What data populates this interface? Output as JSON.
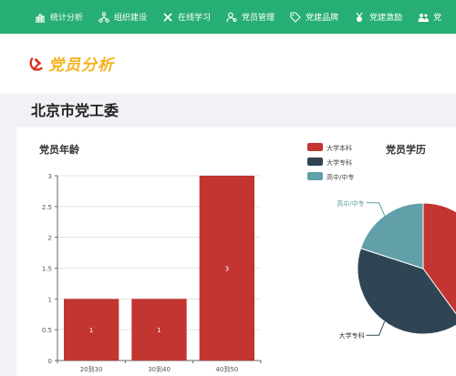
{
  "nav": {
    "items": [
      {
        "label": "统计分析",
        "icon": "bar-chart-icon"
      },
      {
        "label": "组织建设",
        "icon": "org-tree-icon"
      },
      {
        "label": "在线学习",
        "icon": "learning-icon"
      },
      {
        "label": "党员管理",
        "icon": "member-icon"
      },
      {
        "label": "党建品牌",
        "icon": "tag-icon"
      },
      {
        "label": "党建激励",
        "icon": "medal-icon"
      },
      {
        "label": "党",
        "icon": "group-icon"
      }
    ]
  },
  "header": {
    "title": "党员分析",
    "logo_icon": "party-emblem-icon",
    "title_color": "#f5b21b"
  },
  "org": {
    "name": "北京市党工委"
  },
  "colors": {
    "nav": "#27ae74",
    "bar": "#c23531",
    "series1": "#c23531",
    "series2": "#2f4554",
    "series3": "#61a0a8"
  },
  "age_chart": {
    "title": "党员年龄",
    "chart_data": {
      "type": "bar",
      "categories": [
        "20到30",
        "30到40",
        "40到50"
      ],
      "values": [
        1,
        1,
        3
      ],
      "ylim": [
        0,
        3
      ],
      "yticks": [
        "0",
        "0.5",
        "1",
        "1.5",
        "2",
        "2.5",
        "3"
      ],
      "data_labels": [
        "1",
        "1",
        "3"
      ]
    }
  },
  "edu_chart": {
    "title": "党员学历",
    "legend": [
      "大学本科",
      "大学专科",
      "高中/中专"
    ],
    "chart_data": {
      "type": "pie",
      "labels": [
        "大学本科",
        "大学专科",
        "高中/中专"
      ],
      "values": [
        40,
        40,
        20
      ],
      "visible_slice_labels": [
        "高中/中专",
        "大学专科"
      ]
    }
  }
}
